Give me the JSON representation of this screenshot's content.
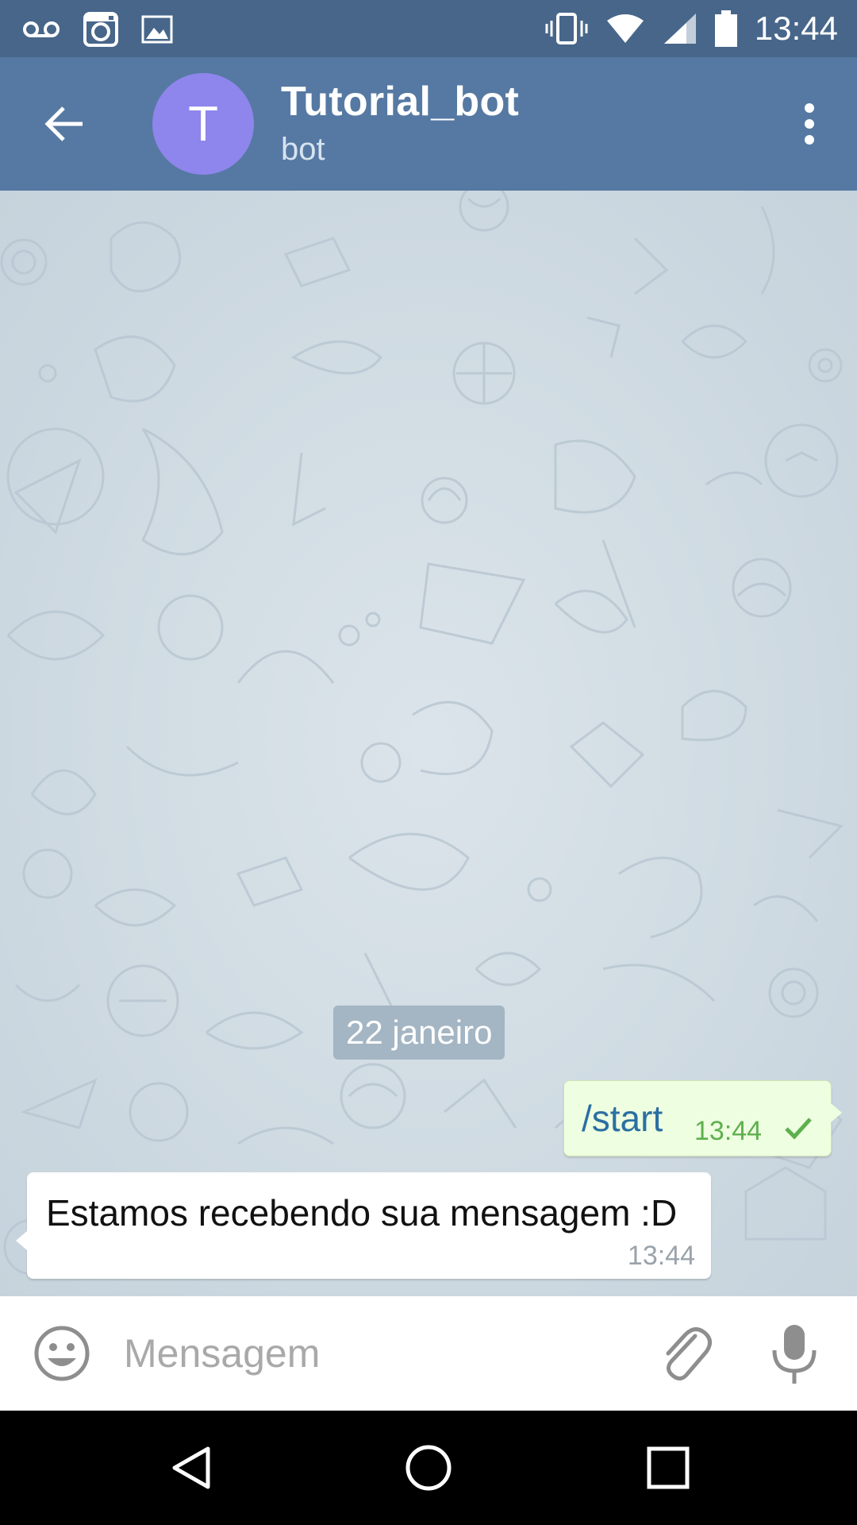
{
  "status_bar": {
    "time": "13:44",
    "left_icons": [
      "voicemail-icon",
      "instagram-icon",
      "image-icon"
    ],
    "right_icons": [
      "vibrate-icon",
      "wifi-icon",
      "signal-icon",
      "battery-icon"
    ]
  },
  "header": {
    "avatar_letter": "T",
    "title": "Tutorial_bot",
    "subtitle": "bot",
    "avatar_color": "#8e86ec",
    "bar_color": "#5679a3"
  },
  "chat": {
    "date": "22 janeiro",
    "messages": [
      {
        "direction": "outgoing",
        "text": "/start",
        "time": "13:44",
        "status": "sent-check-icon"
      },
      {
        "direction": "incoming",
        "text": "Estamos recebendo sua mensagem :D",
        "time": "13:44"
      }
    ]
  },
  "composer": {
    "placeholder": "Mensagem",
    "value": ""
  },
  "nav": {
    "icons": [
      "nav-back-icon",
      "nav-home-icon",
      "nav-recent-icon"
    ]
  }
}
